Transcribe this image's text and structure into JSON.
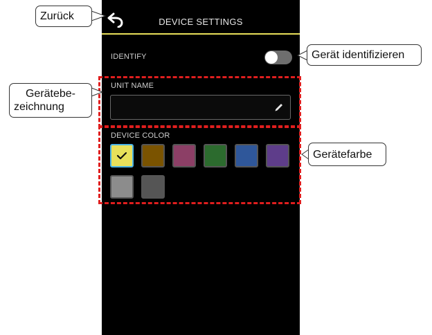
{
  "header": {
    "title": "DEVICE SETTINGS",
    "back_icon": "back-arrow-icon",
    "accent_color": "#e8e05a"
  },
  "identify": {
    "label": "IDENTIFY",
    "toggle_on": false
  },
  "unit_name": {
    "label": "UNIT NAME",
    "value": "",
    "edit_icon": "pencil-icon"
  },
  "device_color": {
    "label": "DEVICE COLOR",
    "selected": 0,
    "swatches": [
      "#e8e05a",
      "#7a5300",
      "#8c3f66",
      "#2c6b2e",
      "#2f579a",
      "#5e3d8a",
      "#8c8c8c",
      "#555555"
    ]
  },
  "annotations": {
    "back": "Zurück",
    "identify": "Gerät identifizieren",
    "unit_name_line1": "Gerätebe-",
    "unit_name_line2": "zeichnung",
    "device_color": "Gerätefarbe",
    "highlight_color": "#e01e1e"
  }
}
